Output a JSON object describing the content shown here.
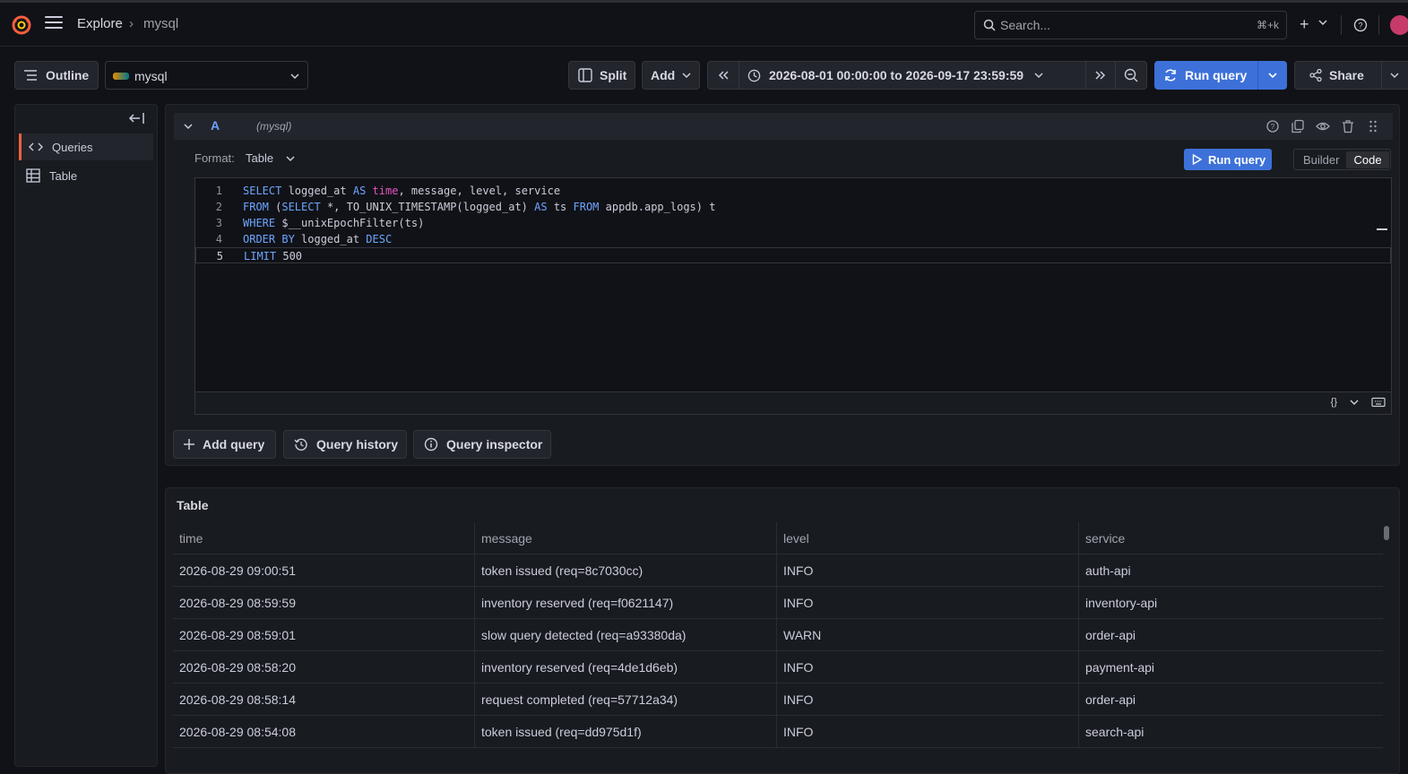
{
  "colors": {
    "accent": "#3d71d9",
    "brand": "#f55f3e",
    "background": "#111217",
    "panel": "#181b1f"
  },
  "header": {
    "breadcrumb": [
      "Explore",
      "mysql"
    ],
    "breadcrumb_sep": "›",
    "search_placeholder": "Search...",
    "search_shortcut": "⌘+k",
    "plus_label": "+"
  },
  "toolbar": {
    "outline_label": "Outline",
    "datasource": "mysql",
    "split_label": "Split",
    "add_label": "Add",
    "time_range": "2026-08-01 00:00:00 to 2026-09-17 23:59:59",
    "run_query_label": "Run query",
    "share_label": "Share"
  },
  "sidebar": {
    "items": [
      {
        "label": "Queries",
        "icon": "code-icon",
        "active": true
      },
      {
        "label": "Table",
        "icon": "table-icon",
        "active": false
      }
    ]
  },
  "query": {
    "ref_id": "A",
    "datasource_name": "(mysql)",
    "format_label": "Format:",
    "format_value": "Table",
    "run_label": "Run query",
    "mode_builder": "Builder",
    "mode_code": "Code",
    "footer_braces": "{}",
    "code_lines": [
      {
        "n": "1",
        "text": "SELECT logged_at AS time, message, level, service"
      },
      {
        "n": "2",
        "text": "FROM (SELECT *, TO_UNIX_TIMESTAMP(logged_at) AS ts FROM appdb.app_logs) t"
      },
      {
        "n": "3",
        "text": "WHERE $__unixEpochFilter(ts)"
      },
      {
        "n": "4",
        "text": "ORDER BY logged_at DESC"
      },
      {
        "n": "5",
        "text": "LIMIT 500"
      }
    ]
  },
  "actions": {
    "add_query": "Add query",
    "query_history": "Query history",
    "query_inspector": "Query inspector"
  },
  "table": {
    "title": "Table",
    "columns": [
      "time",
      "message",
      "level",
      "service"
    ],
    "rows": [
      [
        "2026-08-29 09:00:51",
        "token issued (req=8c7030cc)",
        "INFO",
        "auth-api"
      ],
      [
        "2026-08-29 08:59:59",
        "inventory reserved (req=f0621147)",
        "INFO",
        "inventory-api"
      ],
      [
        "2026-08-29 08:59:01",
        "slow query detected (req=a93380da)",
        "WARN",
        "order-api"
      ],
      [
        "2026-08-29 08:58:20",
        "inventory reserved (req=4de1d6eb)",
        "INFO",
        "payment-api"
      ],
      [
        "2026-08-29 08:58:14",
        "request completed (req=57712a34)",
        "INFO",
        "order-api"
      ],
      [
        "2026-08-29 08:54:08",
        "token issued (req=dd975d1f)",
        "INFO",
        "search-api"
      ]
    ]
  }
}
